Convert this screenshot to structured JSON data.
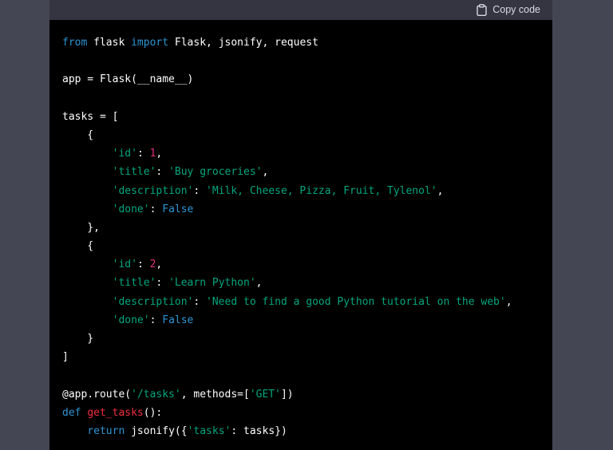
{
  "header": {
    "copy_label": "Copy code",
    "copy_icon": "clipboard-icon"
  },
  "colors": {
    "page_background": "#444654",
    "code_background": "#000000",
    "header_background": "#343541",
    "keyword": "#2e95d3",
    "string": "#00a67d",
    "number": "#df3079",
    "function_name": "#f22c3d",
    "plain": "#ffffff"
  },
  "code": {
    "language": "python",
    "lines": [
      [
        {
          "t": "kw",
          "v": "from"
        },
        {
          "t": "plain",
          "v": " flask "
        },
        {
          "t": "kw",
          "v": "import"
        },
        {
          "t": "plain",
          "v": " Flask, jsonify, request"
        }
      ],
      [],
      [
        {
          "t": "plain",
          "v": "app = Flask(__name__)"
        }
      ],
      [],
      [
        {
          "t": "plain",
          "v": "tasks = ["
        }
      ],
      [
        {
          "t": "plain",
          "v": "    {"
        }
      ],
      [
        {
          "t": "plain",
          "v": "        "
        },
        {
          "t": "str",
          "v": "'id'"
        },
        {
          "t": "plain",
          "v": ": "
        },
        {
          "t": "num",
          "v": "1"
        },
        {
          "t": "plain",
          "v": ","
        }
      ],
      [
        {
          "t": "plain",
          "v": "        "
        },
        {
          "t": "str",
          "v": "'title'"
        },
        {
          "t": "plain",
          "v": ": "
        },
        {
          "t": "str",
          "v": "'Buy groceries'"
        },
        {
          "t": "plain",
          "v": ","
        }
      ],
      [
        {
          "t": "plain",
          "v": "        "
        },
        {
          "t": "str",
          "v": "'description'"
        },
        {
          "t": "plain",
          "v": ": "
        },
        {
          "t": "str",
          "v": "'Milk, Cheese, Pizza, Fruit, Tylenol'"
        },
        {
          "t": "plain",
          "v": ","
        }
      ],
      [
        {
          "t": "plain",
          "v": "        "
        },
        {
          "t": "str",
          "v": "'done'"
        },
        {
          "t": "plain",
          "v": ": "
        },
        {
          "t": "kw",
          "v": "False"
        }
      ],
      [
        {
          "t": "plain",
          "v": "    },"
        }
      ],
      [
        {
          "t": "plain",
          "v": "    {"
        }
      ],
      [
        {
          "t": "plain",
          "v": "        "
        },
        {
          "t": "str",
          "v": "'id'"
        },
        {
          "t": "plain",
          "v": ": "
        },
        {
          "t": "num",
          "v": "2"
        },
        {
          "t": "plain",
          "v": ","
        }
      ],
      [
        {
          "t": "plain",
          "v": "        "
        },
        {
          "t": "str",
          "v": "'title'"
        },
        {
          "t": "plain",
          "v": ": "
        },
        {
          "t": "str",
          "v": "'Learn Python'"
        },
        {
          "t": "plain",
          "v": ","
        }
      ],
      [
        {
          "t": "plain",
          "v": "        "
        },
        {
          "t": "str",
          "v": "'description'"
        },
        {
          "t": "plain",
          "v": ": "
        },
        {
          "t": "str",
          "v": "'Need to find a good Python tutorial on the web'"
        },
        {
          "t": "plain",
          "v": ","
        }
      ],
      [
        {
          "t": "plain",
          "v": "        "
        },
        {
          "t": "str",
          "v": "'done'"
        },
        {
          "t": "plain",
          "v": ": "
        },
        {
          "t": "kw",
          "v": "False"
        }
      ],
      [
        {
          "t": "plain",
          "v": "    }"
        }
      ],
      [
        {
          "t": "plain",
          "v": "]"
        }
      ],
      [],
      [
        {
          "t": "plain",
          "v": "@app.route("
        },
        {
          "t": "str",
          "v": "'/tasks'"
        },
        {
          "t": "plain",
          "v": ", methods=["
        },
        {
          "t": "str",
          "v": "'GET'"
        },
        {
          "t": "plain",
          "v": "])"
        }
      ],
      [
        {
          "t": "kw",
          "v": "def"
        },
        {
          "t": "plain",
          "v": " "
        },
        {
          "t": "fn",
          "v": "get_tasks"
        },
        {
          "t": "plain",
          "v": "():"
        }
      ],
      [
        {
          "t": "plain",
          "v": "    "
        },
        {
          "t": "kw",
          "v": "return"
        },
        {
          "t": "plain",
          "v": " jsonify({"
        },
        {
          "t": "str",
          "v": "'tasks'"
        },
        {
          "t": "plain",
          "v": ": tasks})"
        }
      ]
    ]
  }
}
